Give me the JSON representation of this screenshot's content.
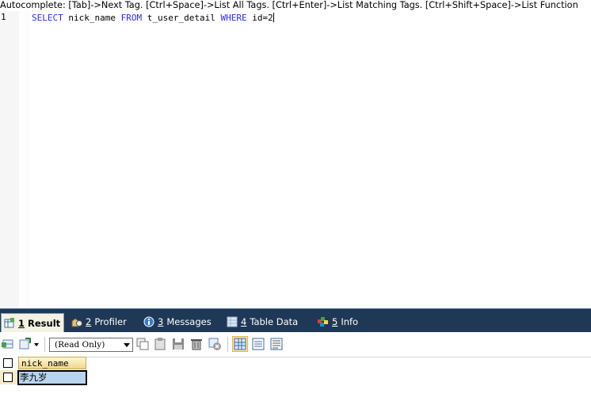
{
  "editor": {
    "hint": "Autocomplete: [Tab]->Next Tag. [Ctrl+Space]->List All Tags. [Ctrl+Enter]->List Matching Tags. [Ctrl+Shift+Space]->List Function",
    "line_number": "1",
    "query": {
      "kw_select": "SELECT",
      "column": " nick_name ",
      "kw_from": "FROM",
      "table": " t_user_detail ",
      "kw_where": "WHERE",
      "condition": " id=2"
    },
    "keyword_color": "#2b2bff"
  },
  "tabs": [
    {
      "num": "1",
      "label": "Result",
      "icon": "result-grid-icon",
      "active": true
    },
    {
      "num": "2",
      "label": "Profiler",
      "icon": "profiler-icon",
      "active": false
    },
    {
      "num": "3",
      "label": "Messages",
      "icon": "messages-icon",
      "active": false
    },
    {
      "num": "4",
      "label": "Table Data",
      "icon": "table-data-icon",
      "active": false
    },
    {
      "num": "5",
      "label": "Info",
      "icon": "info-icon",
      "active": false
    }
  ],
  "toolbar": {
    "mode_select": "(Read Only)"
  },
  "result": {
    "columns": [
      "nick_name"
    ],
    "rows": [
      [
        "李九岁"
      ]
    ]
  },
  "colors": {
    "tab_bar": "#1f3855",
    "header_cell": "#f1d48a",
    "selected_cell": "#b9d4ef"
  }
}
